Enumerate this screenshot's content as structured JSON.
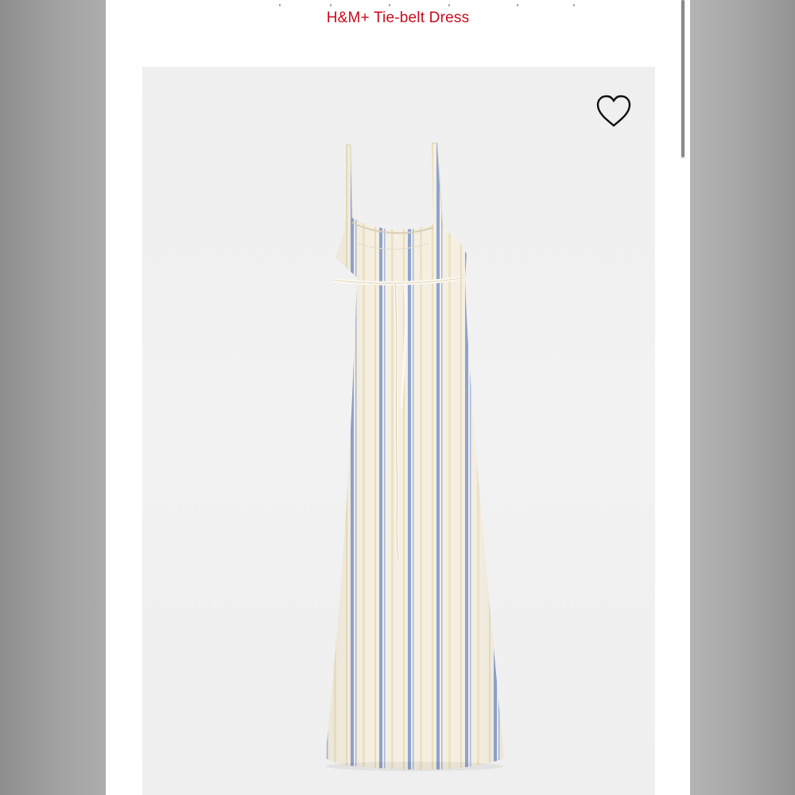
{
  "product": {
    "title": "H&M+ Tie-belt Dress",
    "image_alt": "H&M+ Tie-belt Dress"
  },
  "favorite": {
    "icon": "heart-outline-icon"
  },
  "colors": {
    "title": "#cc0a1c",
    "image_bg": "#f0f0f0",
    "dress_base": "#f4efe1",
    "stripe_blue": "#8ea3d2",
    "stripe_cream": "#ece2c4"
  }
}
